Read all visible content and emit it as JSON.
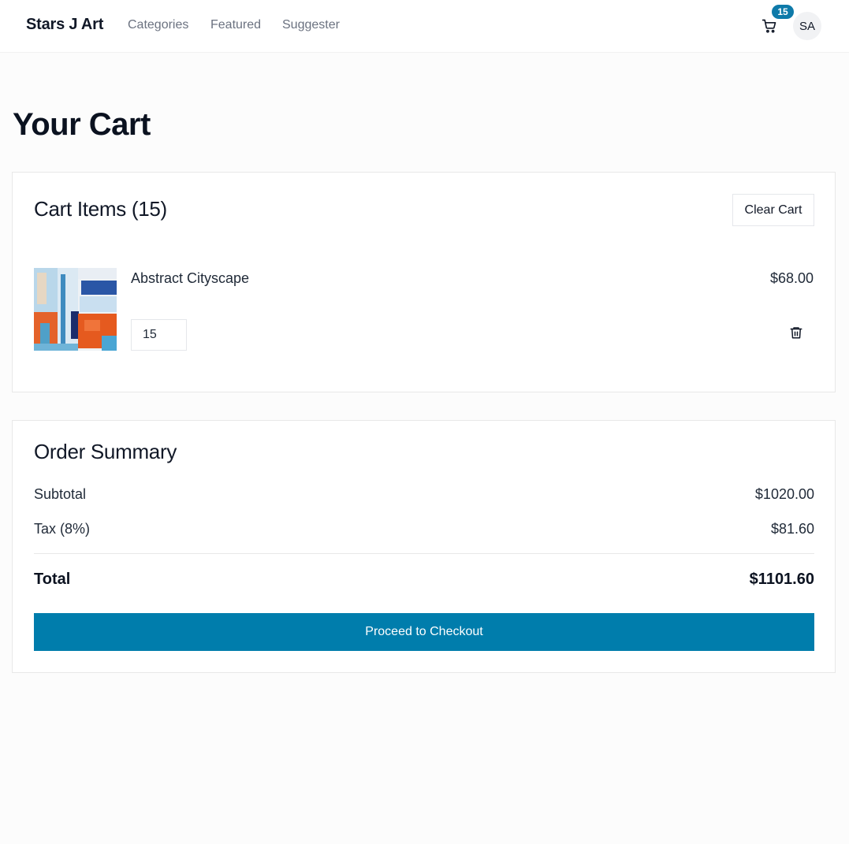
{
  "header": {
    "brand": "Stars J Art",
    "nav": [
      "Categories",
      "Featured",
      "Suggester"
    ],
    "cart_count": "15",
    "avatar_initials": "SA",
    "icons": {
      "cart": "cart-icon"
    }
  },
  "page": {
    "title": "Your Cart"
  },
  "cart": {
    "heading": "Cart Items (15)",
    "clear_label": "Clear Cart",
    "items": [
      {
        "name": "Abstract Cityscape",
        "price": "$68.00",
        "quantity": "15",
        "icons": {
          "remove": "trash-icon"
        }
      }
    ]
  },
  "summary": {
    "heading": "Order Summary",
    "subtotal_label": "Subtotal",
    "subtotal_value": "$1020.00",
    "tax_label": "Tax (8%)",
    "tax_value": "$81.60",
    "total_label": "Total",
    "total_value": "$1101.60",
    "checkout_label": "Proceed to Checkout"
  },
  "colors": {
    "accent": "#007dac",
    "badge": "#0e7aa9",
    "page_background": "#fcfcfc"
  }
}
